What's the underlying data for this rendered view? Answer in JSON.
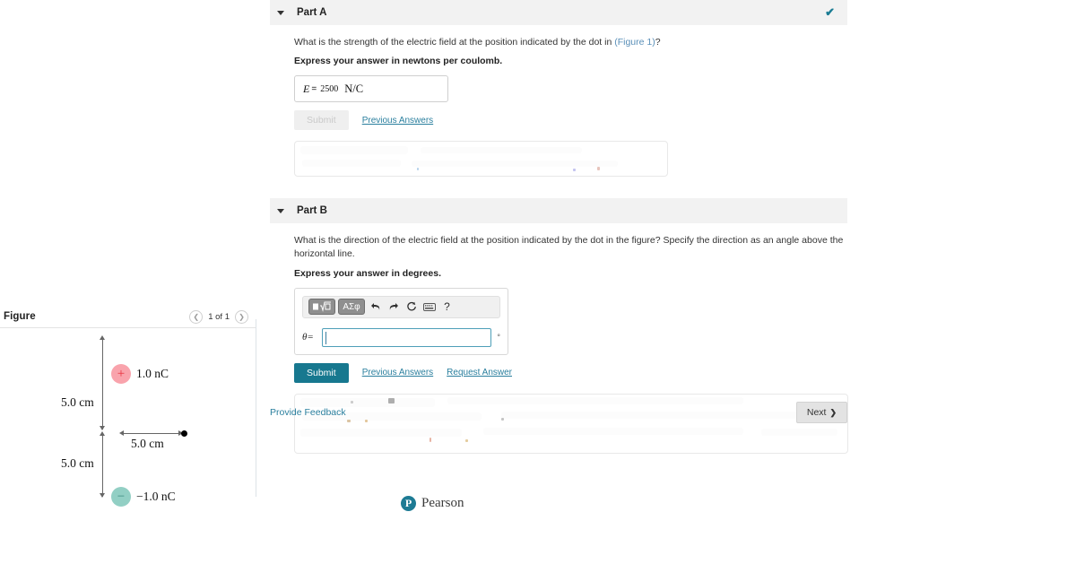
{
  "figure": {
    "title": "Figure",
    "pager": {
      "prev_icon": "chevron-left-icon",
      "label": "1 of 1",
      "next_icon": "chevron-right-icon"
    },
    "charge_positive": {
      "sign": "+",
      "label": "1.0 nC",
      "color": "#f9a3ac",
      "sign_color": "#e8323f"
    },
    "charge_negative": {
      "sign": "−",
      "label": "−1.0 nC",
      "color": "#92cfc4",
      "sign_color": "#3d8d80"
    },
    "dim_top": "5.0 cm",
    "dim_bottom": "5.0 cm",
    "dim_horizontal": "5.0 cm"
  },
  "part_a": {
    "title": "Part A",
    "caret_icon": "caret-down-icon",
    "status_icon": "check-icon",
    "status_color": "#1a7c93",
    "question": "What is the strength of the electric field at the position indicated by the dot in (Figure 1)?",
    "question_pre": "What is the strength of the electric field at the position indicated by the dot in ",
    "question_link": "(Figure 1)",
    "question_post": "?",
    "instruction": "Express your answer in newtons per coulomb.",
    "answer": {
      "symbol": "E",
      "equals": "=",
      "value": "2500",
      "unit": "N/C"
    },
    "submit_label": "Submit",
    "previous_answers_label": "Previous Answers"
  },
  "part_b": {
    "title": "Part B",
    "caret_icon": "caret-down-icon",
    "question": "What is the direction of the electric field at the position indicated by the dot in the figure? Specify the direction as an angle above the horizontal line.",
    "instruction": "Express your answer in degrees.",
    "toolbar": [
      {
        "name": "math-template-button",
        "label": "⬛√□"
      },
      {
        "name": "greek-symbols-button",
        "label": "ΑΣφ"
      },
      {
        "name": "undo-icon",
        "label": "↶"
      },
      {
        "name": "redo-icon",
        "label": "↷"
      },
      {
        "name": "reset-icon",
        "label": "↺"
      },
      {
        "name": "keyboard-icon",
        "label": "⌨"
      },
      {
        "name": "help-icon",
        "label": "?"
      }
    ],
    "answer": {
      "symbol": "θ",
      "equals": "=",
      "value": "",
      "unit": "°"
    },
    "submit_label": "Submit",
    "previous_answers_label": "Previous Answers",
    "request_answer_label": "Request Answer",
    "submit_color": "#17788f"
  },
  "footer": {
    "feedback_label": "Provide Feedback",
    "next_label": "Next",
    "next_icon": "chevron-right-icon"
  },
  "brand": {
    "mark": "P",
    "name": "Pearson",
    "color": "#1d7b94"
  }
}
